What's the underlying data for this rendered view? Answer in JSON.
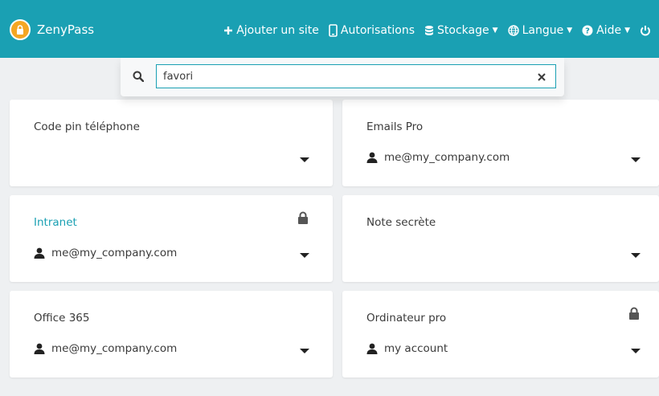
{
  "header": {
    "app_name": "ZenyPass",
    "nav": {
      "add_site": "Ajouter un site",
      "authorizations": "Autorisations",
      "storage": "Stockage",
      "language": "Langue",
      "help": "Aide"
    }
  },
  "search": {
    "value": "favori",
    "placeholder": ""
  },
  "cards": [
    {
      "title": "Code pin téléphone",
      "user": "",
      "locked": false
    },
    {
      "title": "Emails Pro",
      "user": "me@my_company.com",
      "locked": false
    },
    {
      "title": "Intranet",
      "user": "me@my_company.com",
      "locked": true
    },
    {
      "title": "Note secrète",
      "user": "",
      "locked": false
    },
    {
      "title": "Office 365",
      "user": "me@my_company.com",
      "locked": false
    },
    {
      "title": "Ordinateur pro",
      "user": "my account",
      "locked": true
    }
  ],
  "colors": {
    "accent": "#1aa0b3",
    "logo": "#f5a623",
    "background": "#eef0f2"
  }
}
